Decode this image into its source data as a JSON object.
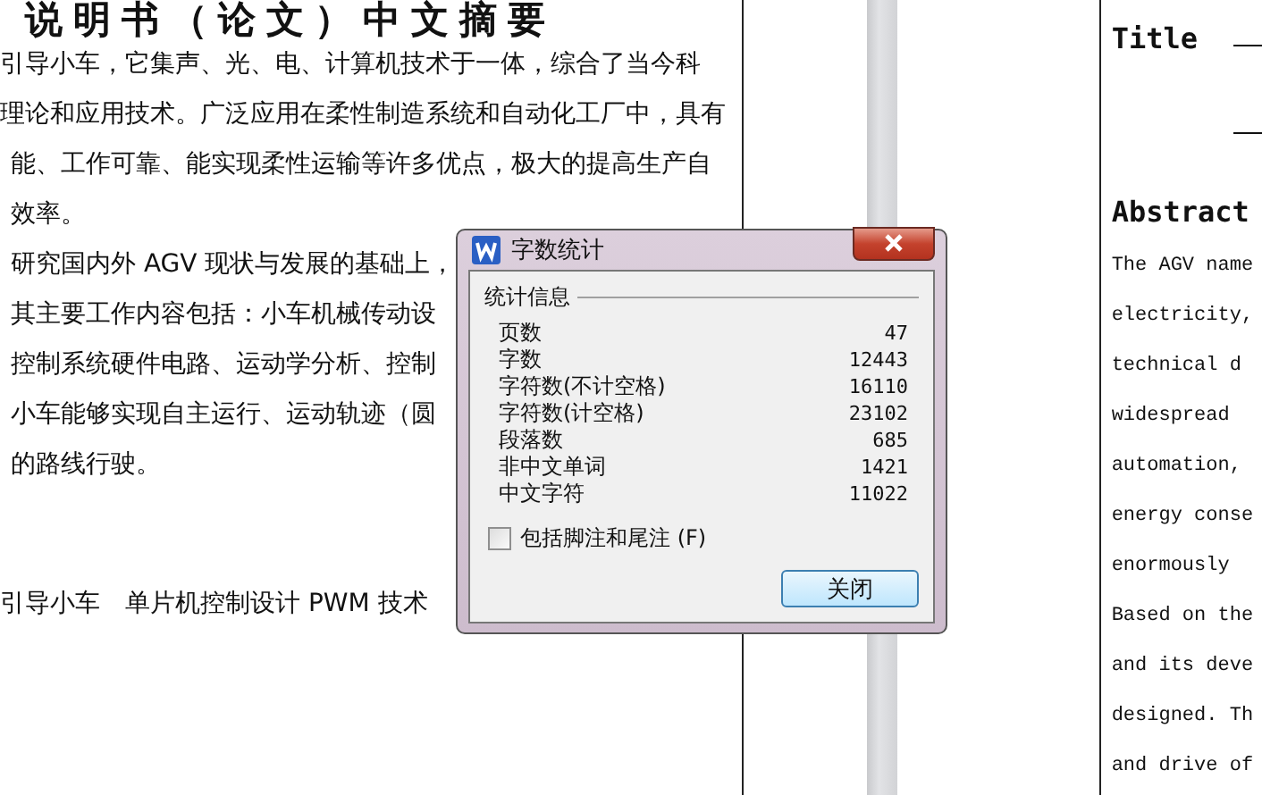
{
  "document": {
    "left_page": {
      "title": "说明书（论文）中文摘要",
      "lines": [
        "引导小车，它集声、光、电、计算机技术于一体，综合了当今科",
        "理论和应用技术。广泛应用在柔性制造系统和自动化工厂中，具有",
        "能、工作可靠、能实现柔性运输等许多优点，极大的提高生产自",
        "效率。",
        "研究国内外 AGV 现状与发展的基础上，",
        "其主要工作内容包括：小车机械传动设",
        "控制系统硬件电路、运动学分析、控制",
        "小车能够实现自主运行、运动轨迹（圆",
        "的路线行驶。"
      ],
      "keywords": "引导小车　单片机控制设计 PWM 技术"
    },
    "right_page": {
      "title": "Title",
      "abstract_heading": "Abstract",
      "lines": [
        "The AGV name",
        "electricity,",
        "technical d",
        "widespread",
        "automation,",
        "energy conse",
        "enormously",
        "Based on the",
        "and its deve",
        "designed. Th",
        "and drive of"
      ]
    }
  },
  "dialog": {
    "title": "字数统计",
    "section": "统计信息",
    "stats": [
      {
        "label": "页数",
        "value": "47"
      },
      {
        "label": "字数",
        "value": "12443"
      },
      {
        "label": "字符数(不计空格)",
        "value": "16110"
      },
      {
        "label": "字符数(计空格)",
        "value": "23102"
      },
      {
        "label": "段落数",
        "value": "685"
      },
      {
        "label": "非中文单词",
        "value": "1421"
      },
      {
        "label": "中文字符",
        "value": "11022"
      }
    ],
    "option": {
      "label": "包括脚注和尾注 (F)",
      "checked": false
    },
    "button": "关闭"
  }
}
